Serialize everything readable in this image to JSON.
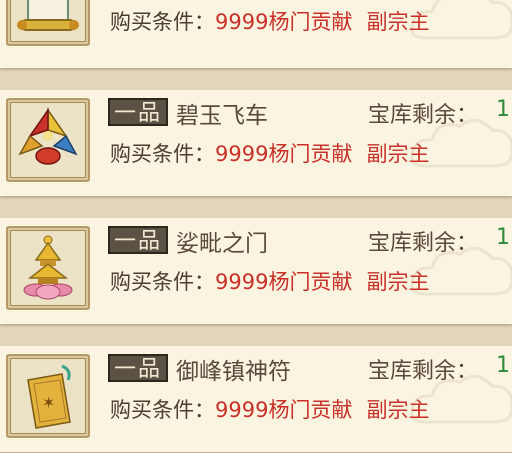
{
  "items": [
    {
      "icon": "scroll-icon",
      "grade": "",
      "name": "",
      "stock_label": "",
      "stock_value": "",
      "cond_label": "购买条件：",
      "cond_cost": "9999杨门贡献",
      "cond_rank": "副宗主"
    },
    {
      "icon": "flying-chariot-icon",
      "grade": "一品",
      "name": "碧玉飞车",
      "stock_label": "宝库剩余：",
      "stock_value": "1",
      "cond_label": "购买条件：",
      "cond_cost": "9999杨门贡献",
      "cond_rank": "副宗主"
    },
    {
      "icon": "golden-pagoda-icon",
      "grade": "一品",
      "name": "娑毗之门",
      "stock_label": "宝库剩余：",
      "stock_value": "1",
      "cond_label": "购买条件：",
      "cond_cost": "9999杨门贡献",
      "cond_rank": "副宗主"
    },
    {
      "icon": "talisman-icon",
      "grade": "一品",
      "name": "御峰镇神符",
      "stock_label": "宝库剩余：",
      "stock_value": "1",
      "cond_label": "购买条件：",
      "cond_cost": "9999杨门贡献",
      "cond_rank": "副宗主"
    }
  ]
}
